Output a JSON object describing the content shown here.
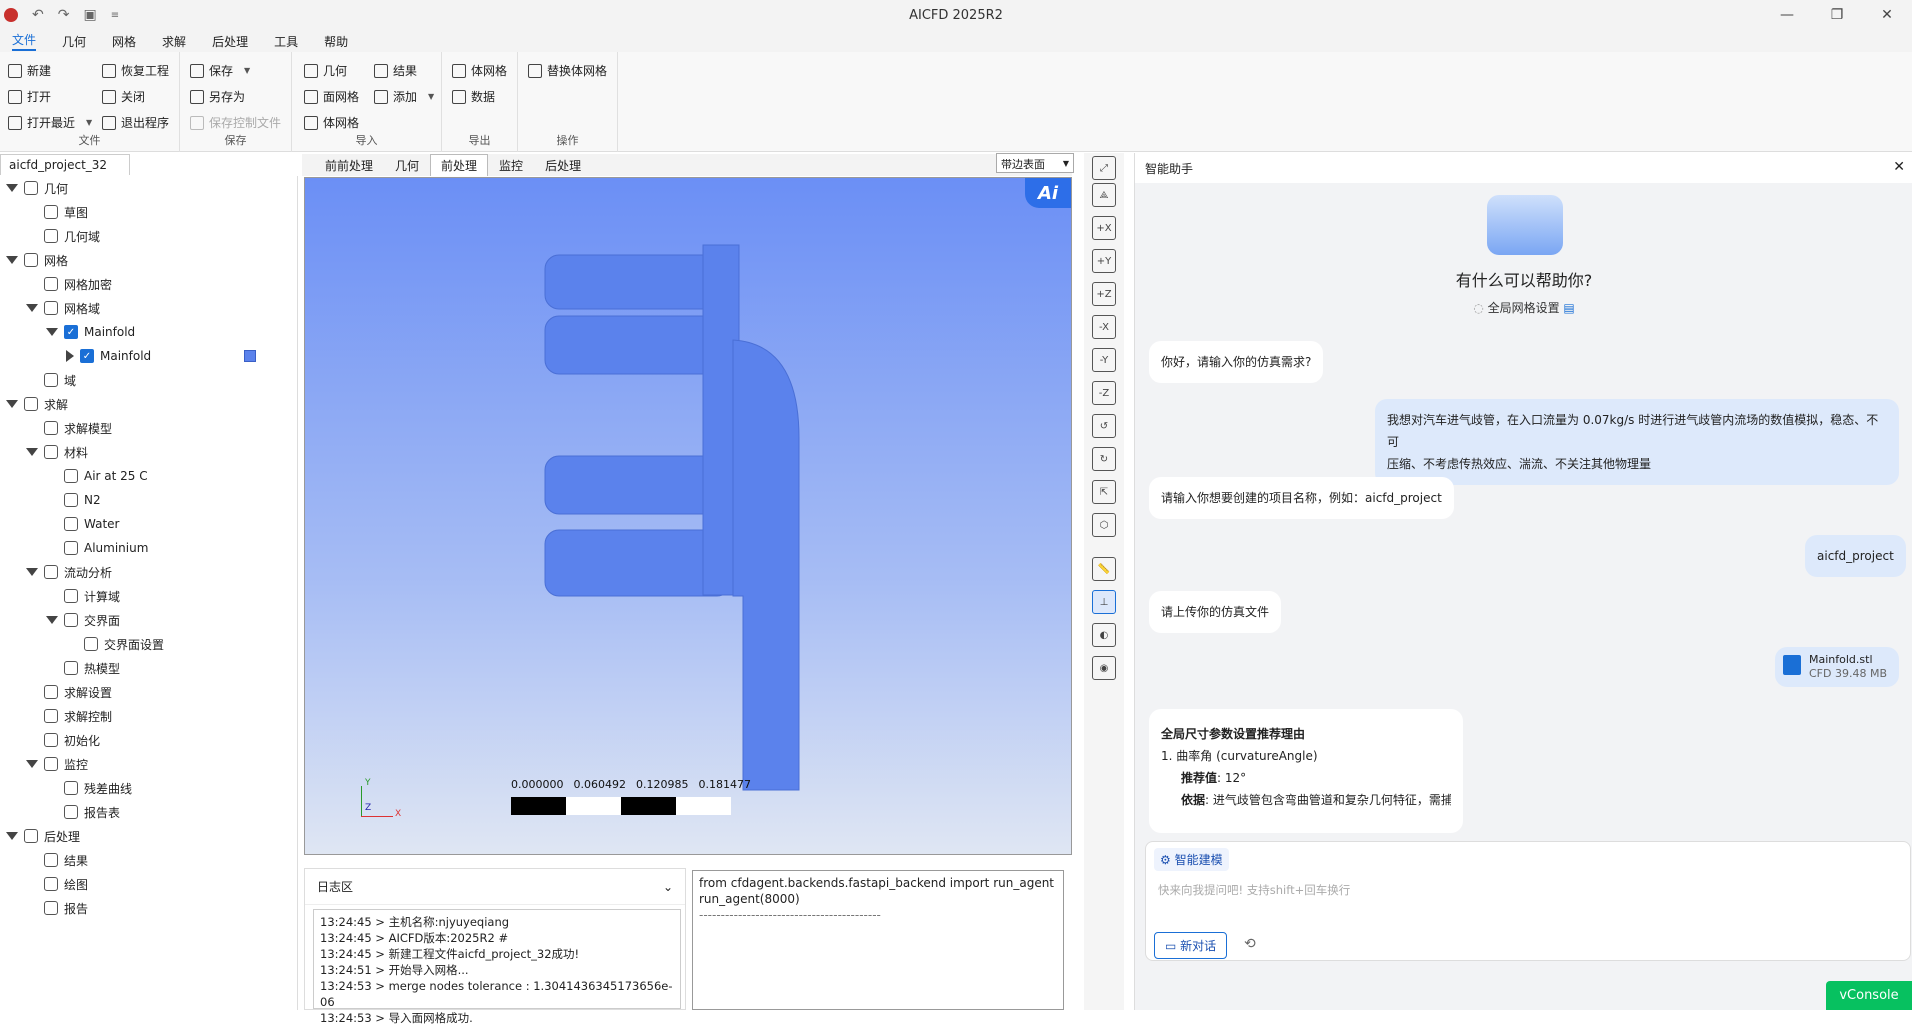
{
  "window": {
    "title": "AICFD 2025R2"
  },
  "menu": [
    "文件",
    "几何",
    "网格",
    "求解",
    "后处理",
    "工具",
    "帮助"
  ],
  "ribbon": {
    "file": {
      "label": "文件",
      "new": "新建",
      "open": "打开",
      "recent": "打开最近",
      "restore": "恢复工程",
      "close": "关闭",
      "exit": "退出程序"
    },
    "save": {
      "label": "保存",
      "save": "保存",
      "save_as": "另存为",
      "save_ctrl": "保存控制文件"
    },
    "import": {
      "label": "导入",
      "geometry": "几何",
      "surface_mesh": "面网格",
      "volume_mesh": "体网格",
      "result": "结果",
      "add": "添加"
    },
    "export": {
      "label": "导出",
      "volume_mesh": "体网格",
      "data": "数据"
    },
    "ops": {
      "label": "操作",
      "replace": "替换体网格"
    }
  },
  "project_tab": "aicfd_project_32",
  "tree": [
    {
      "label": "几何",
      "depth": 0,
      "exp": "d"
    },
    {
      "label": "草图",
      "depth": 1
    },
    {
      "label": "几何域",
      "depth": 1
    },
    {
      "label": "网格",
      "depth": 0,
      "exp": "d"
    },
    {
      "label": "网格加密",
      "depth": 1
    },
    {
      "label": "网格域",
      "depth": 1,
      "exp": "d"
    },
    {
      "label": "Mainfold",
      "depth": 2,
      "exp": "d",
      "chk": true
    },
    {
      "label": "Mainfold",
      "depth": 3,
      "exp": "r",
      "chk": true,
      "sw": true
    },
    {
      "label": "域",
      "depth": 1
    },
    {
      "label": "求解",
      "depth": 0,
      "exp": "d"
    },
    {
      "label": "求解模型",
      "depth": 1
    },
    {
      "label": "材料",
      "depth": 1,
      "exp": "d"
    },
    {
      "label": "Air at 25 C",
      "depth": 2
    },
    {
      "label": "N2",
      "depth": 2
    },
    {
      "label": "Water",
      "depth": 2
    },
    {
      "label": "Aluminium",
      "depth": 2
    },
    {
      "label": "流动分析",
      "depth": 1,
      "exp": "d"
    },
    {
      "label": "计算域",
      "depth": 2
    },
    {
      "label": "交界面",
      "depth": 2,
      "exp": "d"
    },
    {
      "label": "交界面设置",
      "depth": 3
    },
    {
      "label": "热模型",
      "depth": 2
    },
    {
      "label": "求解设置",
      "depth": 1
    },
    {
      "label": "求解控制",
      "depth": 1
    },
    {
      "label": "初始化",
      "depth": 1
    },
    {
      "label": "监控",
      "depth": 1,
      "exp": "d"
    },
    {
      "label": "残差曲线",
      "depth": 2
    },
    {
      "label": "报告表",
      "depth": 2
    },
    {
      "label": "后处理",
      "depth": 0,
      "exp": "d"
    },
    {
      "label": "结果",
      "depth": 1
    },
    {
      "label": "绘图",
      "depth": 1
    },
    {
      "label": "报告",
      "depth": 1
    }
  ],
  "view_tabs": [
    "前前处理",
    "几何",
    "前处理",
    "监控",
    "后处理"
  ],
  "view_mode": "带边表面",
  "scale": [
    "0.000000",
    "0.060492",
    "0.120985",
    "0.181477"
  ],
  "axes": {
    "x": "X",
    "y": "Y",
    "z": "Z"
  },
  "ai_badge": "Ai",
  "log": {
    "title": "日志区",
    "lines": [
      "13:24:45 > 主机名称:njyuyeqiang",
      "13:24:45 > AICFD版本:2025R2 #",
      "13:24:45 > 新建工程文件aicfd_project_32成功!",
      "13:24:51 > 开始导入网格...",
      "13:24:53 > merge nodes tolerance : 1.3041436345173656e-06",
      "13:24:53 > 导入面网格成功."
    ]
  },
  "console": [
    "from cfdagent.backends.fastapi_backend import run_agent",
    "run_agent(8000)",
    "------------------------------------------"
  ],
  "assistant": {
    "title": "智能助手",
    "welcome": "有什么可以帮助你?",
    "global_setting": "全局网格设置",
    "msg1": "你好，请输入你的仿真需求?",
    "user1a": "我想对汽车进气歧管，在入口流量为 0.07kg/s 时进行进气歧管内流场的数值模拟，稳态、不可",
    "user1b": "压缩、不考虑传热效应、湍流、不关注其他物理量",
    "msg2": "请输入你想要创建的项目名称，例如：aicfd_project",
    "user2": "aicfd_project",
    "msg3": "请上传你的仿真文件",
    "file_name": "Mainfold.stl",
    "file_meta": "CFD 39.48 MB",
    "reason_title": "全局尺寸参数设置推荐理由",
    "reason_item": "1. 曲率角 (curvatureAngle)",
    "rec_label": "推荐值",
    "rec_value": ": 12°",
    "basis_label": "依据",
    "basis_value": ": 进气歧管包含弯曲管道和复杂几何特征，需捕",
    "chip": "智能建模",
    "placeholder": "快来向我提问吧! 支持shift+回车换行",
    "new_chat": "新对话"
  },
  "vconsole": "vConsole"
}
